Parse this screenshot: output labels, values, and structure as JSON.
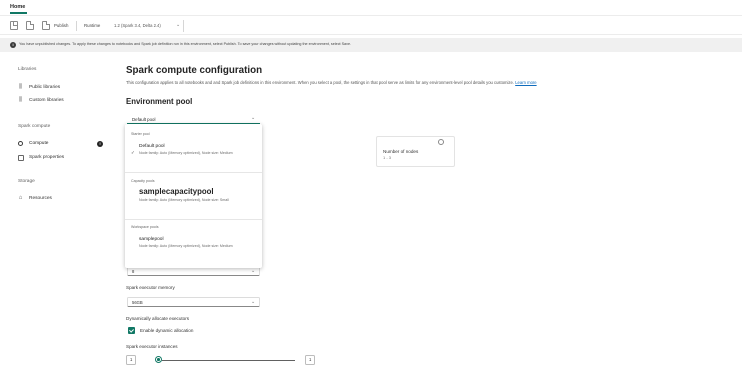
{
  "header": {
    "home_tab": "Home"
  },
  "toolbar": {
    "save_icon": "save-icon",
    "publish_label": "Publish",
    "runtime_label": "Runtime",
    "runtime_value": "1.2 (Spark 3.4, Delta 2.4)"
  },
  "banner": {
    "text": "You have unpublished changes. To apply these changes to notebooks and Spark job definition run in this environment, select Publish. To save your changes without updating the environment, select Save."
  },
  "sidebar": {
    "libraries_heading": "Libraries",
    "public_libraries": "Public libraries",
    "custom_libraries": "Custom libraries",
    "spark_compute_heading": "Spark compute",
    "compute": "Compute",
    "compute_badge": "!",
    "spark_properties": "Spark properties",
    "storage_heading": "Storage",
    "resources": "Resources"
  },
  "main": {
    "title": "Spark compute configuration",
    "description": "This configuration applies to all notebooks and and Spark job definitions in this environment. When you select a pool, the settings in that pool serve as limits for any environment-level pool details you customize.",
    "learn_more": "Learn more",
    "environment_pool_heading": "Environment pool",
    "pool_select_value": "Default pool",
    "card": {
      "label": "Number of nodes",
      "value": "1 - 3"
    }
  },
  "dropdown": {
    "groups": [
      {
        "label": "Starter pool",
        "items": [
          {
            "name": "Default pool",
            "meta": "Node family: Auto (Memory optimized), Node size: Medium",
            "selected": true
          }
        ]
      },
      {
        "label": "Capacity pools",
        "items": [
          {
            "name": "samplecapacitypool",
            "meta": "Node family: Auto (Memory optimized), Node size: Small",
            "selected": false
          }
        ]
      },
      {
        "label": "Workspace pools",
        "items": [
          {
            "name": "samplepool",
            "meta": "Node family: Auto (Memory optimized), Node size: Medium",
            "selected": false
          }
        ]
      }
    ],
    "check_glyph": "✓"
  },
  "fields": {
    "executor_cores_value": "8",
    "executor_memory_label": "Spark executor memory",
    "executor_memory_value": "56GB",
    "dynamic_label": "Dynamically allocate executors",
    "dynamic_checkbox_label": "Enable dynamic allocation",
    "dynamic_checked": true,
    "instances_label": "Spark executor instances",
    "instances_min": "1",
    "instances_max": "1"
  },
  "colors": {
    "accent": "#117865",
    "link": "#0f6cbd",
    "banner_bg": "#f0f0f0"
  }
}
